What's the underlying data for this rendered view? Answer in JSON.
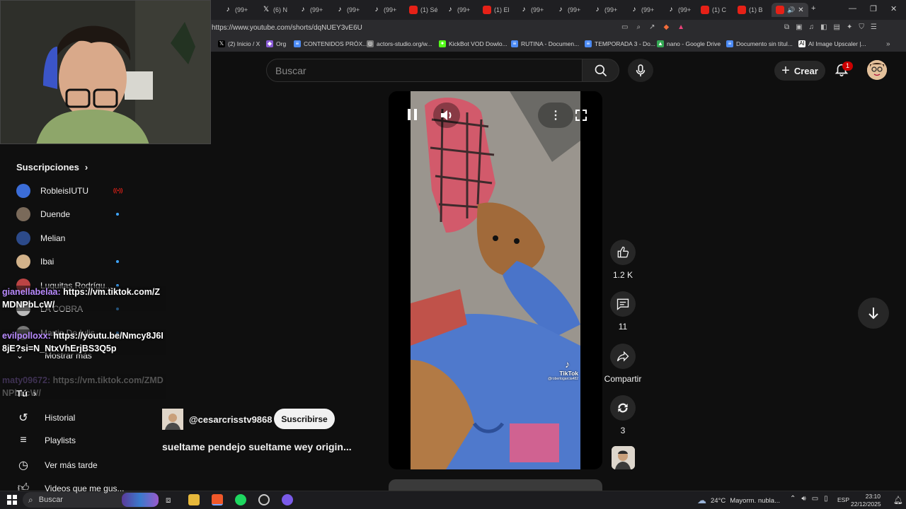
{
  "browser": {
    "url": "https://www.youtube.com/shorts/dqNUEY3vE6U",
    "tabs": [
      {
        "label": "(99+",
        "icon": "tiktok"
      },
      {
        "label": "(6) N",
        "icon": "x"
      },
      {
        "label": "(99+",
        "icon": "tiktok"
      },
      {
        "label": "(99+",
        "icon": "tiktok"
      },
      {
        "label": "(99+",
        "icon": "tiktok"
      },
      {
        "label": "(1) Sé",
        "icon": "youtube"
      },
      {
        "label": "(99+",
        "icon": "tiktok"
      },
      {
        "label": "(1) El",
        "icon": "youtube"
      },
      {
        "label": "(99+",
        "icon": "tiktok"
      },
      {
        "label": "(99+",
        "icon": "tiktok"
      },
      {
        "label": "(99+",
        "icon": "tiktok"
      },
      {
        "label": "(99+",
        "icon": "tiktok"
      },
      {
        "label": "(99+",
        "icon": "tiktok"
      },
      {
        "label": "(1) C",
        "icon": "youtube"
      },
      {
        "label": "(1) B",
        "icon": "youtube"
      }
    ],
    "bookmarks": [
      {
        "label": "(2) Inicio / X",
        "icon": "x"
      },
      {
        "label": "Org",
        "icon": "org"
      },
      {
        "label": "CONTENIDOS PRÓX...",
        "icon": "docs"
      },
      {
        "label": "actors-studio.org/w...",
        "icon": "globe"
      },
      {
        "label": "KickBot VOD Dowlo...",
        "icon": "kick"
      },
      {
        "label": "RUTINA - Documen...",
        "icon": "docs"
      },
      {
        "label": "TEMPORADA 3 - Do...",
        "icon": "docs"
      },
      {
        "label": "nano - Google Drive",
        "icon": "drive"
      },
      {
        "label": "Documento sin títul...",
        "icon": "docs"
      },
      {
        "label": "AI Image Upscaler |...",
        "icon": "ai"
      }
    ]
  },
  "youtube": {
    "search_placeholder": "Buscar",
    "create_label": "Crear",
    "notifications_count": "1"
  },
  "sidebar": {
    "subscriptions_title": "Suscripciones",
    "subscriptions": [
      {
        "name": "RobleisIUTU",
        "status": "live"
      },
      {
        "name": "Duende",
        "status": "dot"
      },
      {
        "name": "Melian",
        "status": ""
      },
      {
        "name": "Ibai",
        "status": "dot"
      },
      {
        "name": "Luquitas Rodrígu...",
        "status": "dot"
      },
      {
        "name": "LA COBRA",
        "status": "dot"
      },
      {
        "name": "Martin De Iulis",
        "status": "dot"
      }
    ],
    "more_label": "Mostrar más",
    "you_title": "Tú",
    "you_items": [
      {
        "label": "Historial",
        "icon": "history-icon"
      },
      {
        "label": "Playlists",
        "icon": "playlist-icon"
      },
      {
        "label": "Ver más tarde",
        "icon": "clock-icon"
      },
      {
        "label": "Videos que me gus...",
        "icon": "like-icon"
      }
    ]
  },
  "chat": [
    {
      "user": "gianellabelaa:",
      "text": " https://vm.tiktok.com/ZMDNPbLcW/"
    },
    {
      "user": "evilpolloxx:",
      "text": " https://youtu.be/Nmcy8J6I8jE?si=N_NtxVhErjBS3Q5p"
    },
    {
      "user": "maty09672:",
      "text": " https://vm.tiktok.com/ZMDNPbLcW/",
      "faded": true
    }
  ],
  "short": {
    "channel": "@cesarcrisstv9868",
    "subscribe_label": "Suscribirse",
    "title": "sueltame pendejo sueltame wey  origin...",
    "watermark": "TikTok",
    "watermark_user": "@robertogarcia482",
    "likes": "1.2 K",
    "comments": "11",
    "share_label": "Compartir",
    "remix_count": "3"
  },
  "taskbar": {
    "search_label": "Buscar",
    "weather": "24°C",
    "weather_desc": "Mayorm. nubla...",
    "lang": "ESP",
    "time": "23:10",
    "date": "22/12/2025"
  }
}
